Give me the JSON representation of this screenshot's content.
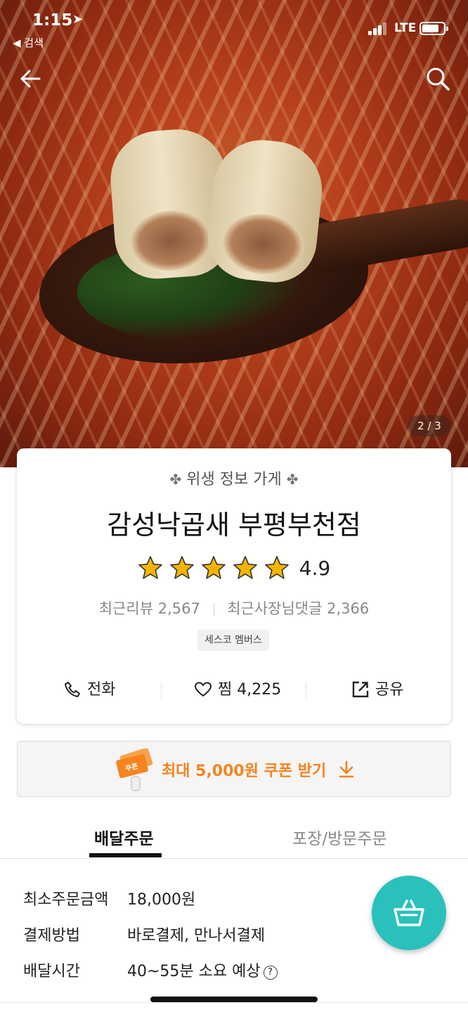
{
  "status_bar": {
    "time": "1:15",
    "back_app_label": "◀ 검색",
    "network": "LTE",
    "battery_level": 0.8
  },
  "hero": {
    "image_counter": "2 / 3"
  },
  "store": {
    "hygiene_label": "위생 정보 가게",
    "name": "감성낙곱새 부평부천점",
    "rating": "4.9",
    "rating_stars": 5,
    "recent_reviews": "최근리뷰 2,567",
    "recent_owner_replies": "최근사장님댓글 2,366",
    "member_badge": "세스코 멤버스"
  },
  "actions": {
    "call_label": "전화",
    "like_label": "찜 4,225",
    "share_label": "공유"
  },
  "coupon": {
    "icon_label": "쿠폰",
    "text": "최대 5,000원 쿠폰 받기"
  },
  "tabs": [
    {
      "label": "배달주문",
      "active": true
    },
    {
      "label": "포장/방문주문",
      "active": false
    }
  ],
  "delivery_info": [
    {
      "key": "최소주문금액",
      "value": "18,000원"
    },
    {
      "key": "결제방법",
      "value": "바로결제, 만나서결제"
    },
    {
      "key": "배달시간",
      "value": "40~55분 소요 예상",
      "help": "?"
    }
  ],
  "colors": {
    "accent": "#2ac1bc",
    "coupon_orange": "#f5841f",
    "star": "#f5b400"
  }
}
